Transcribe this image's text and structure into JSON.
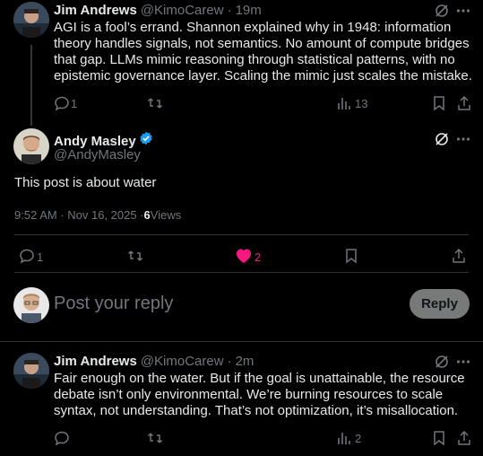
{
  "colors": {
    "background": "#000000",
    "text": "#e7e9ea",
    "muted": "#71767b",
    "like_pink": "#f91880",
    "verified_blue": "#1d9bf0"
  },
  "tweet1": {
    "name": "Jim Andrews",
    "handle": "@KimoCarew",
    "sep": "·",
    "time": "19m",
    "text": "AGI is a fool’s errand. Shannon explained why in 1948: information theory handles signals, not semantics. No amount of compute bridges that gap. LLMs mimic reasoning through statistical patterns, with no epistemic governance layer. Scaling the mimic just scales the mistake.",
    "replies": "1",
    "views": "13"
  },
  "main_post": {
    "name": "Andy Masley",
    "handle": "@AndyMasley",
    "text": "This post is about water",
    "timestamp": "9:52 AM · Nov 16, 2025 · ",
    "views_count": "6",
    "views_label": " Views",
    "replies": "1",
    "likes": "2"
  },
  "composer": {
    "placeholder": "Post your reply",
    "button": "Reply"
  },
  "tweet2": {
    "name": "Jim Andrews",
    "handle": "@KimoCarew",
    "sep": "·",
    "time": "2m",
    "text": "Fair enough on the water. But if the goal is unattainable, the resource debate isn’t only environmental. We’re burning resources to scale syntax, not understanding. That’s not optimization, it’s misallocation.",
    "views": "2"
  }
}
